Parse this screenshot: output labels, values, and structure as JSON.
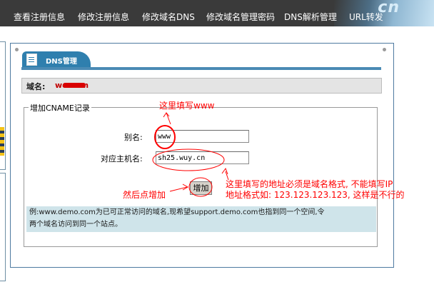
{
  "nav": {
    "items": [
      {
        "label": "查看注册信息"
      },
      {
        "label": "修改注册信息"
      },
      {
        "label": "修改域名DNS"
      },
      {
        "label": "修改域名管理密码"
      },
      {
        "label": "DNS解析管理"
      },
      {
        "label": "URL转发"
      }
    ],
    "deco_text": "cn"
  },
  "panel": {
    "tab_label": "DNS管理",
    "domain_label": "域名:",
    "domain_value": "wo        com"
  },
  "form": {
    "legend": "增加CNAME记录",
    "alias_label": "别名:",
    "alias_value": "www",
    "host_label": "对应主机名:",
    "host_value": "sh25.wuy.cn",
    "submit_label": "增加",
    "note_line1": "例:www.demo.com为已可正常访问的域名,现希望support.demo.com也指到同一个空间,令",
    "note_line2": "两个域名访问到同一个站点。"
  },
  "annotations": {
    "fill_www": "这里填写www",
    "host_line1": "这里填写的地址必须是域名格式, 不能填写IP",
    "host_line2": "地址格式如: 123.123.123.123, 这样是不行的",
    "then_click": "然后点增加"
  },
  "colors": {
    "nav_bg": "#3a3a3a",
    "tab_blue": "#2f7fae",
    "annotation_red": "#ff0000",
    "note_bg": "#cfe4ea"
  }
}
